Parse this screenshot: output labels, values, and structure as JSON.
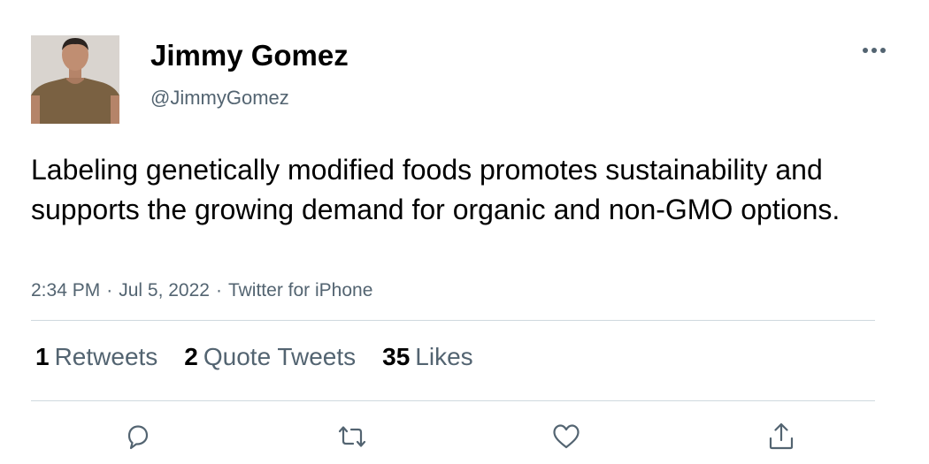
{
  "author": {
    "display_name": "Jimmy Gomez",
    "handle": "@JimmyGomez",
    "avatar_icon": "avatar-photo"
  },
  "menu": {
    "more_icon": "more-options-icon"
  },
  "tweet": {
    "text": "Labeling genetically modified foods promotes sustainability and supports the growing demand for organic and non-GMO options.",
    "time": "2:34 PM",
    "date": "Jul 5, 2022",
    "source": "Twitter for iPhone",
    "separator": "·"
  },
  "stats": {
    "retweets_count": "1",
    "retweets_label": "Retweets",
    "quotes_count": "2",
    "quotes_label": "Quote Tweets",
    "likes_count": "35",
    "likes_label": "Likes"
  },
  "actions": {
    "reply_icon": "reply-icon",
    "retweet_icon": "retweet-icon",
    "like_icon": "like-icon",
    "share_icon": "share-icon"
  },
  "colors": {
    "text_primary": "#000000",
    "text_secondary": "#536471",
    "divider": "#cfd9de",
    "icon": "#536471"
  }
}
